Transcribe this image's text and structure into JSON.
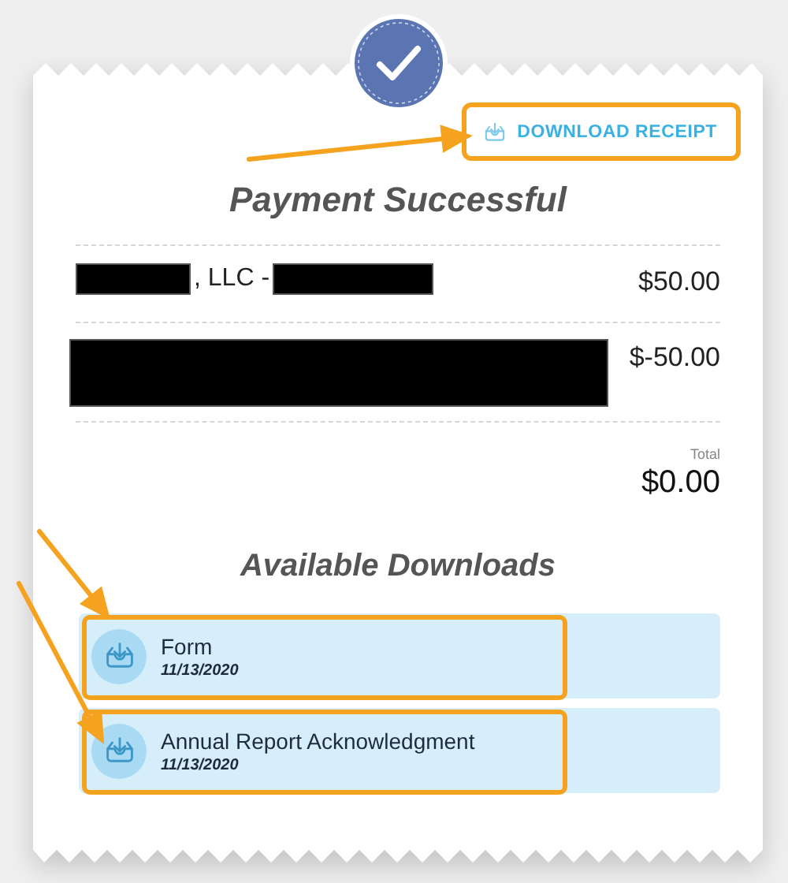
{
  "download_receipt": {
    "label": "DOWNLOAD RECEIPT",
    "highlighted": true
  },
  "title": "Payment Successful",
  "line_items": [
    {
      "parts": [
        {
          "kind": "redaction"
        },
        {
          "kind": "text",
          "text": ", LLC -"
        },
        {
          "kind": "redaction"
        }
      ],
      "amount": "$50.00"
    },
    {
      "parts": [
        {
          "kind": "redaction"
        }
      ],
      "amount": "$-50.00"
    }
  ],
  "total": {
    "label": "Total",
    "amount": "$0.00"
  },
  "downloads": {
    "title": "Available Downloads",
    "items": [
      {
        "name": "Form",
        "date": "11/13/2020",
        "highlighted": true
      },
      {
        "name": "Annual Report Acknowledgment",
        "date": "11/13/2020",
        "highlighted": true
      }
    ]
  },
  "annotations": [
    {
      "kind": "arrow"
    },
    {
      "kind": "arrow"
    },
    {
      "kind": "arrow"
    }
  ]
}
